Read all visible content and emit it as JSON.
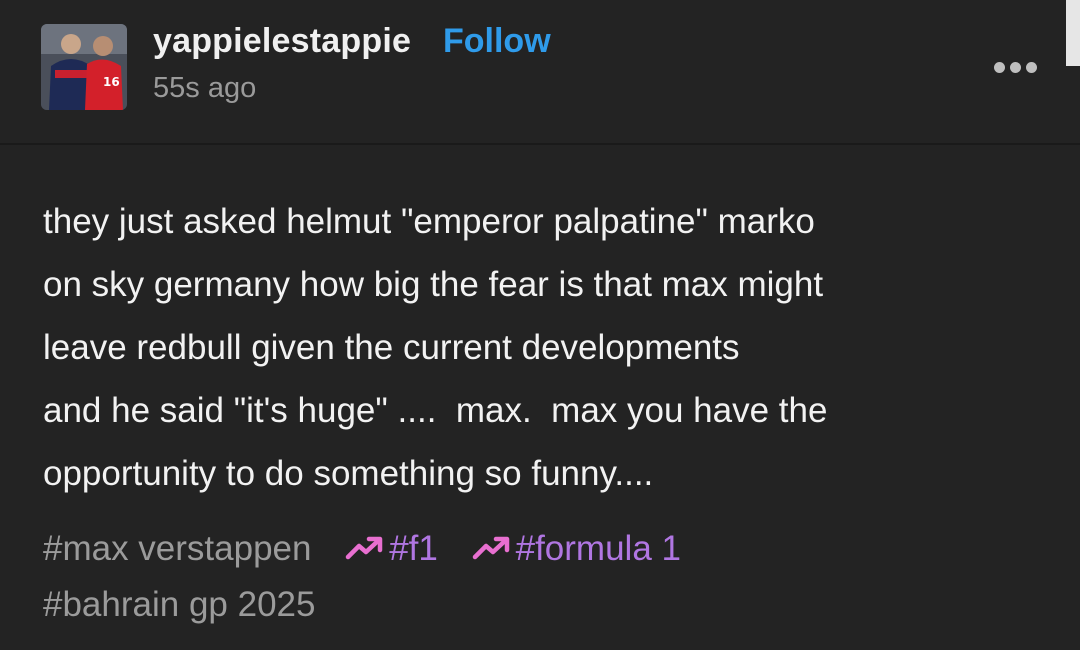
{
  "post": {
    "username": "yappielestappie",
    "follow_label": "Follow",
    "timestamp": "55s ago",
    "avatar_badge": "16",
    "menu_icon": "more-dots-icon",
    "body_lines": [
      "they just asked helmut \"emperor palpatine\" marko",
      "on sky germany how big the fear is that max might",
      "leave redbull given the current developments",
      "and he said \"it's huge\" ....  max.  max you have the",
      "opportunity to do something so funny...."
    ],
    "tags": [
      {
        "label": "#max verstappen",
        "trending": false
      },
      {
        "label": "#f1",
        "trending": true
      },
      {
        "label": "#formula 1",
        "trending": true
      },
      {
        "label": "#bahrain gp 2025",
        "trending": false
      }
    ]
  },
  "colors": {
    "background": "#232323",
    "follow": "#2f9bea",
    "trending_icon": "#e86fd0",
    "trending_text": "#b076e2",
    "tag": "#9b9b9b"
  }
}
